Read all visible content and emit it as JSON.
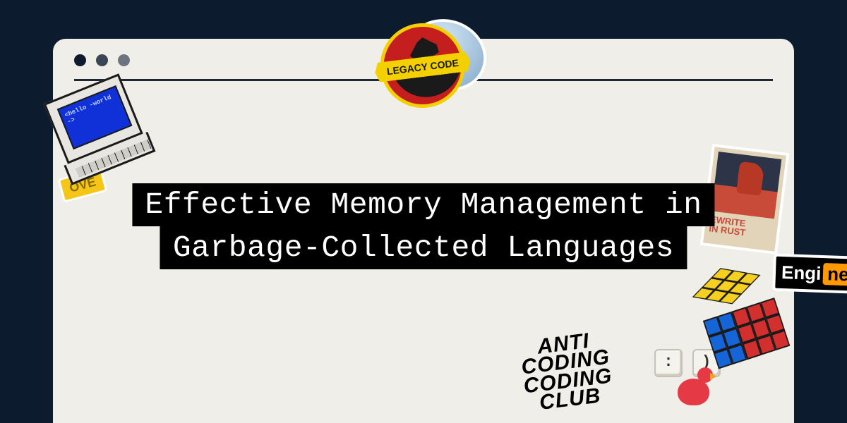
{
  "title": {
    "line1": "Effective Memory Management in",
    "line2": "Garbage-Collected Languages"
  },
  "stickers": {
    "legacy_code_banner": "LEGACY CODE",
    "computer_screen_text": "<hello\n-world ->",
    "ov_label": "OVE",
    "rust_line1": "EWRITE",
    "rust_line2": "IN RUST",
    "engineer_left": "Engi",
    "engineer_right": "nee",
    "anti_line1": "ANTI",
    "anti_line2": "CODING",
    "anti_line3": "CODING",
    "anti_line4": "CLUB",
    "key1": ":",
    "key2": ")"
  }
}
